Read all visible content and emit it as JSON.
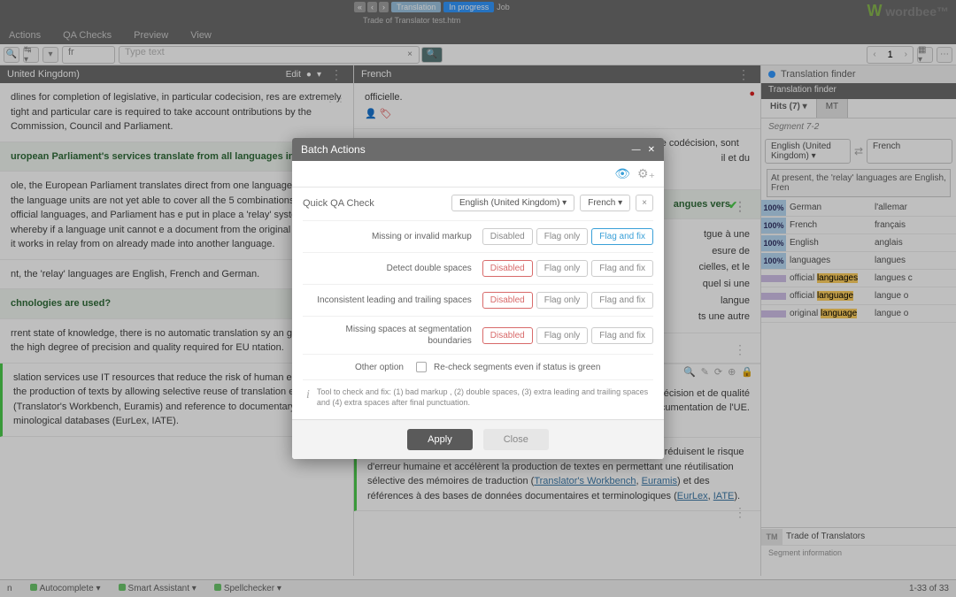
{
  "top": {
    "translation": "Translation",
    "status": "In progress",
    "job": "Job",
    "file": "Trade of Translator test.htm"
  },
  "brand": "wordbee",
  "menu": {
    "actions": "Actions",
    "qa": "QA Checks",
    "preview": "Preview",
    "view": "View"
  },
  "toolbar": {
    "fr": "fr",
    "type_text": "Type text",
    "page": "1"
  },
  "left": {
    "head": "United Kingdom)",
    "edit": "Edit",
    "seg1": "dlines for completion of legislative, in particular codecision, res are extremely tight and particular care is required to take account ontributions by the Commission, Council and Parliament.",
    "seg2": "uropean Parliament's services translate from all languages into es?",
    "seg3": "ole, the European Parliament translates direct from one language  however, the language units are not yet able to cover all the 5 combinations of the 23 official languages, and Parliament has e put in place a 'relay' system whereby if a language unit cannot e a document from the original language, it works in relay from on already made into another language.",
    "seg4": "nt, the 'relay' languages are English, French and German.",
    "seg5": "chnologies are used?",
    "seg6": "rrent state of knowledge, there is no automatic translation sy an guarantee the high degree of precision and quality required for EU ntation.",
    "seg7": "slation services use IT resources that reduce the risk of human error ed up the production of texts by allowing selective reuse of translation es (Translator's Workbench, Euramis) and reference to documentary minological databases (EurLex, IATE)."
  },
  "right": {
    "head": "French",
    "seg0": "officielle.",
    "seg1": "Les délais d'achèvement des procédures législatives, en particulier de codécision, sont extrêmement serrés et une attention particulière est requise",
    "seg1b": "il et du",
    "seg2a": "angues vers",
    "seg3a": "tgue à une",
    "seg3b": "esure de",
    "seg3c": "cielles, et le",
    "seg3d": "quel si une",
    "seg3e": "langue",
    "seg3f": "ts une autre",
    "seg6": "e traduction automatique qui puisse garantir le haut degré de précision et de qualité requis pour la documentation de l'UE.",
    "seg7": "Les services de traduction utilisent des ressources informatiques qui réduisent le risque d'erreur humaine et accélèrent la production de textes en permettant une réutilisation sélective des mémoires de traduction (",
    "seg7_tw": "Translator's Workbench",
    "seg7_eu": "Euramis",
    "seg7_mid": ") et des références à des bases de données documentaires et terminologiques (",
    "seg7_el": "EurLex",
    "seg7_ia": "IATE",
    "seg7_end": ")."
  },
  "finder": {
    "title": "Translation finder",
    "sub": "Translation finder",
    "hits": "Hits (7)",
    "mt": "MT",
    "seginfo": "Segment 7-2",
    "src_lang": "English (United Kingdom)",
    "tgt_lang": "French",
    "ref": "At present, the 'relay' languages are English, Fren",
    "rows": [
      {
        "pct": "100%",
        "cls": "p100",
        "src": "German",
        "tgt": "l'allemar"
      },
      {
        "pct": "100%",
        "cls": "p100",
        "src": "French",
        "tgt": "français"
      },
      {
        "pct": "100%",
        "cls": "p100",
        "src": "English",
        "tgt": "anglais"
      },
      {
        "pct": "100%",
        "cls": "p100",
        "src": "languages",
        "tgt": "langues"
      },
      {
        "pct": "",
        "cls": "pblank",
        "src": "official <mark>languages</mark>",
        "tgt": "langues c"
      },
      {
        "pct": "",
        "cls": "pblank",
        "src": "official <mark>language</mark>",
        "tgt": "langue o"
      },
      {
        "pct": "",
        "cls": "pblank",
        "src": "original <mark>language</mark>",
        "tgt": "langue o"
      }
    ],
    "tm": "TM",
    "tm_label": "Trade of Translators",
    "si": "Segment information"
  },
  "modal": {
    "title": "Batch Actions",
    "quick": "Quick QA Check",
    "src": "English (United Kingdom)",
    "tgt": "French",
    "rows": [
      {
        "name": "Missing or invalid markup",
        "active": 2
      },
      {
        "name": "Detect double spaces",
        "active": 0
      },
      {
        "name": "Inconsistent leading and trailing spaces",
        "active": 0
      },
      {
        "name": "Missing spaces at segmentation boundaries",
        "active": 0
      }
    ],
    "btn_disabled": "Disabled",
    "btn_flagonly": "Flag only",
    "btn_flagfix": "Flag and fix",
    "other": "Other option",
    "recheck": "Re-check segments even if status is green",
    "help": "Tool to check and fix: (1) bad markup , (2) double spaces, (3) extra leading and trailing spaces and (4) extra spaces after final punctuation.",
    "apply": "Apply",
    "close": "Close"
  },
  "status": {
    "n": "n",
    "auto": "Autocomplete",
    "smart": "Smart Assistant",
    "spell": "Spellchecker",
    "pager": "1-33 of 33"
  }
}
